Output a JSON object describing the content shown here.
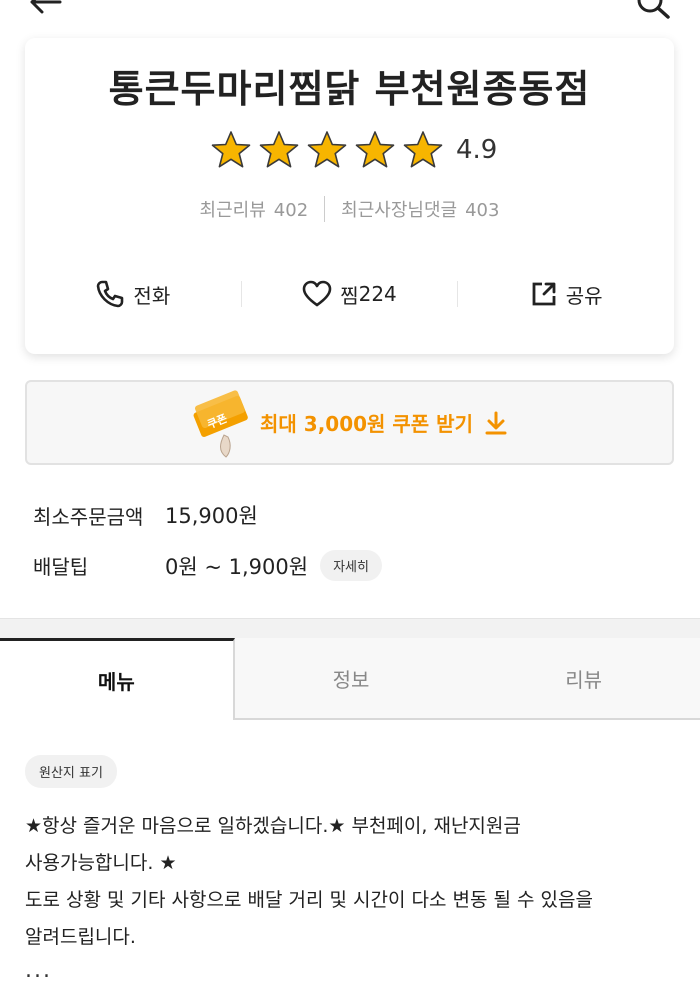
{
  "store": {
    "name": "통큰두마리찜닭 부천원종동점",
    "rating": "4.9",
    "rating_stars": 5,
    "recent_reviews_label": "최근리뷰",
    "recent_reviews_count": "402",
    "owner_replies_label": "최근사장님댓글",
    "owner_replies_count": "403"
  },
  "actions": {
    "call_label": "전화",
    "like_label": "찜",
    "like_count": "224",
    "share_label": "공유"
  },
  "coupon": {
    "badge_text": "쿠폰",
    "label": "최대 3,000원 쿠폰 받기"
  },
  "order_info": {
    "min_order_label": "최소주문금액",
    "min_order_value": "15,900원",
    "delivery_tip_label": "배달팁",
    "delivery_tip_value": "0원 ~ 1,900원",
    "detail_button": "자세히"
  },
  "tabs": [
    {
      "label": "메뉴",
      "active": true
    },
    {
      "label": "정보",
      "active": false
    },
    {
      "label": "리뷰",
      "active": false
    }
  ],
  "origin_button": "원산지 표기",
  "notice": {
    "line1": "★항상 즐거운 마음으로 일하겠습니다.★ 부천페이, 재난지원금",
    "line2": "사용가능합니다. ★",
    "line3": "도로 상황 및 기타 사항으로 배달 거리 및 시간이 다소 변동 될 수 있음을",
    "line4": "알려드립니다.",
    "more": "..."
  },
  "colors": {
    "accent": "#f39200",
    "star": "#f7b500",
    "text": "#222222",
    "muted": "#999999"
  }
}
